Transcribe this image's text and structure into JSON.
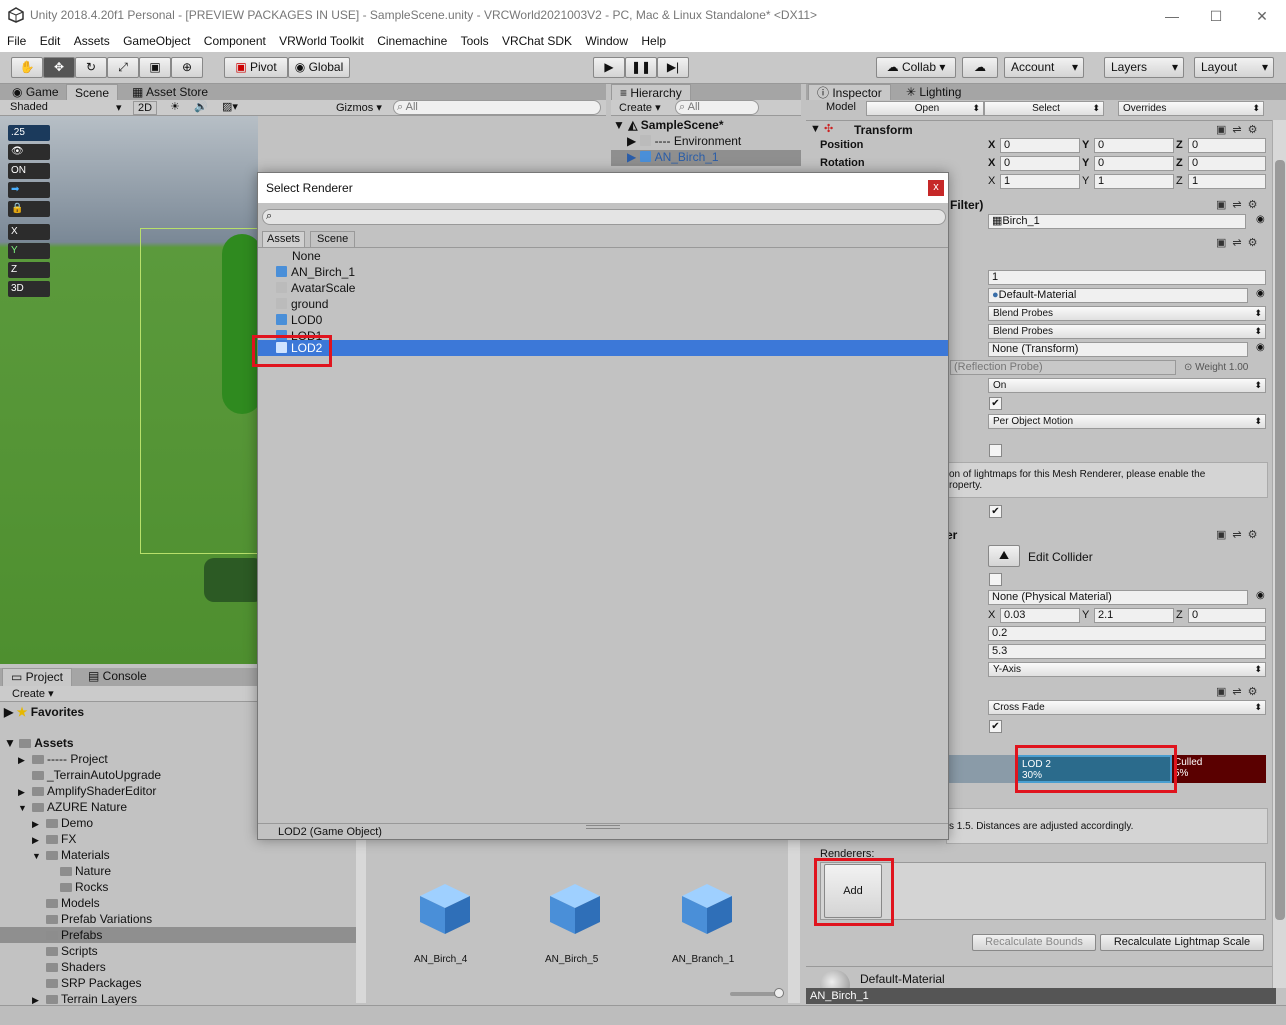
{
  "window": {
    "title": "Unity 2018.4.20f1 Personal - [PREVIEW PACKAGES IN USE] - SampleScene.unity - VRCWorld2021003V2 - PC, Mac & Linux Standalone* <DX11>",
    "minimize": "—",
    "maximize": "☐",
    "close": "✕"
  },
  "menu": [
    "File",
    "Edit",
    "Assets",
    "GameObject",
    "Component",
    "VRWorld Toolkit",
    "Cinemachine",
    "Tools",
    "VRChat SDK",
    "Window",
    "Help"
  ],
  "toolbar": {
    "pivot": "Pivot",
    "global": "Global",
    "collab": "Collab ▾",
    "account": "Account",
    "layers": "Layers",
    "layout": "Layout"
  },
  "scene_panel": {
    "tabs": [
      "Game",
      "Scene",
      "Asset Store"
    ],
    "shading": "Shaded",
    "mode_2d": "2D",
    "gizmos": "Gizmos ▾",
    "search_placeholder": "All",
    "badges": [
      ".25",
      "",
      "ON",
      "",
      "",
      "X",
      "Y",
      "Z",
      "3D"
    ]
  },
  "hierarchy": {
    "tab": "Hierarchy",
    "create": "Create ▾",
    "search_placeholder": "All",
    "scene": "SampleScene*",
    "items": [
      "---- Environment",
      "AN_Birch_1"
    ]
  },
  "inspector": {
    "tabs": [
      "Inspector",
      "Lighting"
    ],
    "model_label": "Model",
    "open": "Open",
    "select": "Select",
    "overrides": "Overrides",
    "transform": "Transform",
    "position_label": "Position",
    "rotation_label": "Rotation",
    "position": [
      "0",
      "0",
      "0"
    ],
    "rotation": [
      "0",
      "0",
      "0"
    ],
    "scale": [
      "1",
      "1",
      "1"
    ],
    "mesh_filter_header": "Filter)",
    "mesh": "Birch_1",
    "count_value": "1",
    "material": "Default-Material",
    "light_probes": "Blend Probes",
    "reflection_probes": "Blend Probes",
    "anchor": "None (Transform)",
    "reflection_probe_hint": "(Reflection Probe)",
    "weight": "Weight 1.00",
    "cast_shadows": "On",
    "motion_vectors": "Per Object Motion",
    "lightmap_hint_1": "on of lightmaps for this Mesh Renderer, please enable the",
    "lightmap_hint_2": "roperty.",
    "collider_header": "er",
    "edit_collider": "Edit Collider",
    "physic_material": "None (Physical Material)",
    "center": [
      "0.03",
      "2.1",
      "0"
    ],
    "radius": "0.2",
    "height": "5.3",
    "direction": "Y-Axis",
    "fade_mode": "Cross Fade",
    "lod_label": "LOD 2",
    "lod_percent": "30%",
    "culled_label": "Culled",
    "culled_percent": "5%",
    "distances_hint": "s 1.5. Distances are adjusted accordingly.",
    "renderers_label": "Renderers:",
    "add": "Add",
    "recalc_bounds": "Recalculate Bounds",
    "recalc_lightmap": "Recalculate Lightmap Scale",
    "material_footer": "Default-Material",
    "footer_name": "AN_Birch_1"
  },
  "project": {
    "tabs": [
      "Project",
      "Console"
    ],
    "create": "Create ▾",
    "favorites": "Favorites",
    "assets": "Assets",
    "tree": [
      {
        "label": "----- Project",
        "indent": 1,
        "arrow": true
      },
      {
        "label": "_TerrainAutoUpgrade",
        "indent": 1,
        "arrow": false
      },
      {
        "label": "AmplifyShaderEditor",
        "indent": 1,
        "arrow": true
      },
      {
        "label": "AZURE Nature",
        "indent": 1,
        "arrow": true,
        "open": true
      },
      {
        "label": "Demo",
        "indent": 2,
        "arrow": true
      },
      {
        "label": "FX",
        "indent": 2,
        "arrow": true
      },
      {
        "label": "Materials",
        "indent": 2,
        "arrow": true,
        "open": true
      },
      {
        "label": "Nature",
        "indent": 3,
        "arrow": false
      },
      {
        "label": "Rocks",
        "indent": 3,
        "arrow": false
      },
      {
        "label": "Models",
        "indent": 2,
        "arrow": false
      },
      {
        "label": "Prefab Variations",
        "indent": 2,
        "arrow": false
      },
      {
        "label": "Prefabs",
        "indent": 2,
        "arrow": false,
        "selected": true
      },
      {
        "label": "Scripts",
        "indent": 2,
        "arrow": false
      },
      {
        "label": "Shaders",
        "indent": 2,
        "arrow": false
      },
      {
        "label": "SRP Packages",
        "indent": 2,
        "arrow": false
      },
      {
        "label": "Terrain Layers",
        "indent": 2,
        "arrow": true
      }
    ],
    "thumbs": [
      "AN_Birch_4",
      "AN_Birch_5",
      "AN_Branch_1"
    ]
  },
  "dialog": {
    "title": "Select Renderer",
    "close": "x",
    "tabs": [
      "Assets",
      "Scene"
    ],
    "items": [
      "None",
      "AN_Birch_1",
      "AvatarScale",
      "ground",
      "LOD0",
      "LOD1",
      "LOD2"
    ],
    "footer": "LOD2 (Game Object)"
  }
}
